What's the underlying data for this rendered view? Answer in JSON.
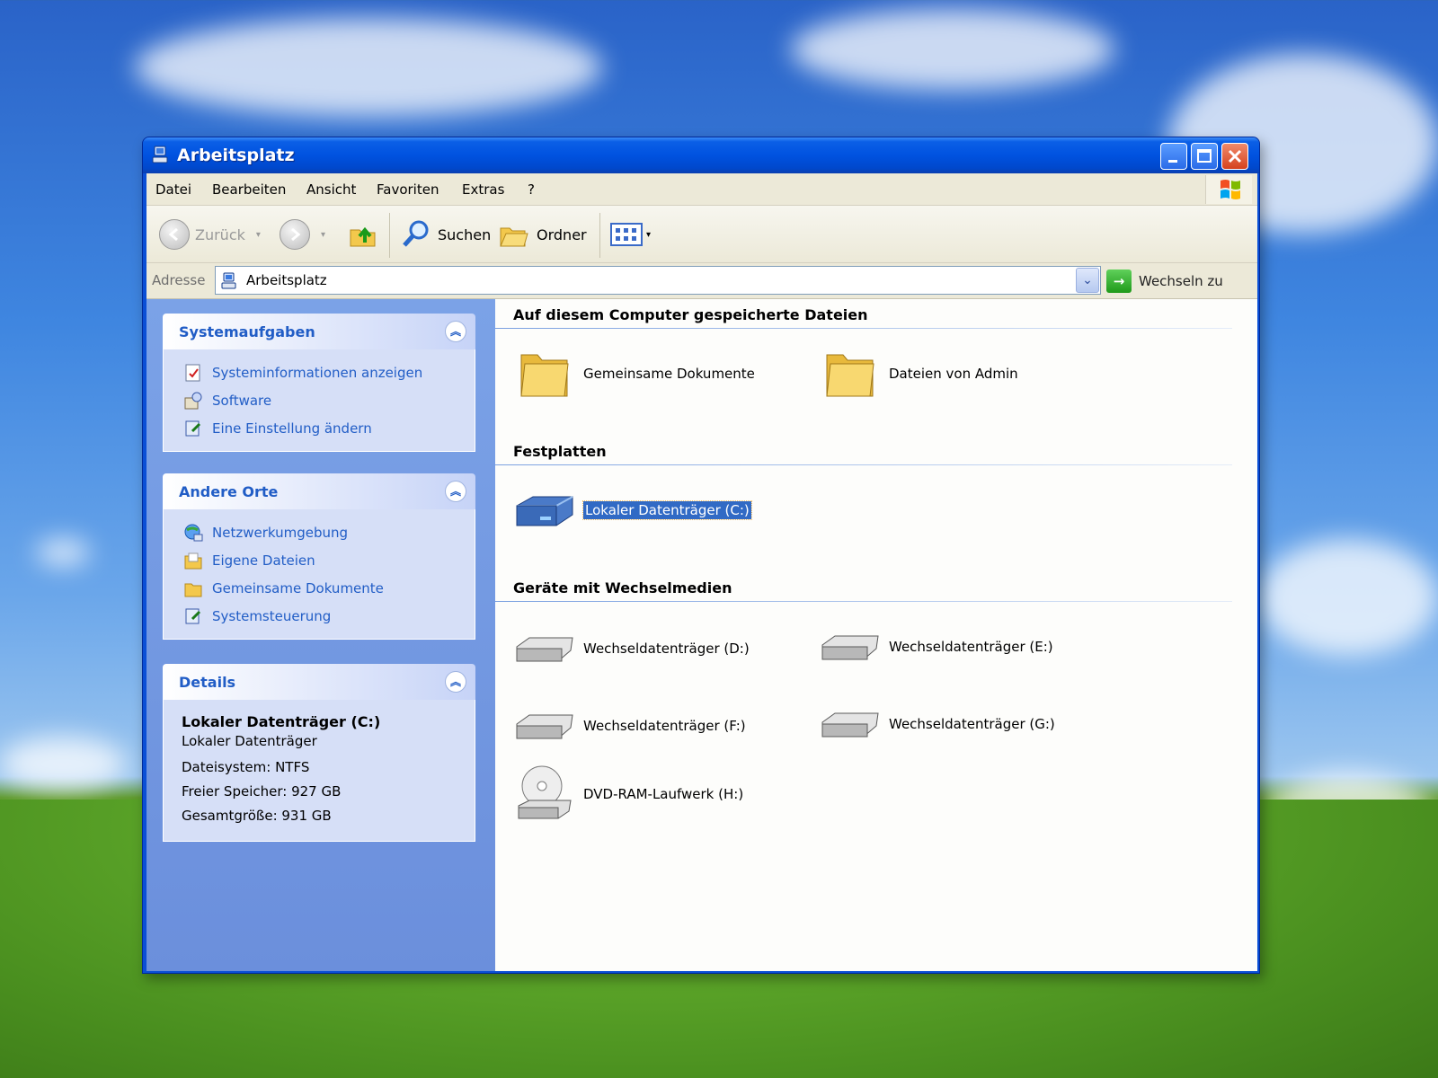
{
  "window": {
    "title": "Arbeitsplatz"
  },
  "menu": [
    "Datei",
    "Bearbeiten",
    "Ansicht",
    "Favoriten",
    "Extras",
    "?"
  ],
  "toolbar": {
    "back_label": "Zurück",
    "search_label": "Suchen",
    "folders_label": "Ordner"
  },
  "address": {
    "label": "Adresse",
    "value": "Arbeitsplatz",
    "go_label": "Wechseln zu"
  },
  "sidebar": {
    "system_tasks": {
      "title": "Systemaufgaben",
      "items": [
        "Systeminformationen anzeigen",
        "Software",
        "Eine Einstellung ändern"
      ]
    },
    "other_places": {
      "title": "Andere Orte",
      "items": [
        "Netzwerkumgebung",
        "Eigene Dateien",
        "Gemeinsame Dokumente",
        "Systemsteuerung"
      ]
    },
    "details": {
      "title": "Details",
      "name": "Lokaler Datenträger (C:)",
      "type": "Lokaler Datenträger",
      "filesystem": "Dateisystem: NTFS",
      "free": "Freier Speicher: 927 GB",
      "total": "Gesamtgröße: 931 GB"
    }
  },
  "content": {
    "stored_files": {
      "title": "Auf diesem Computer gespeicherte Dateien",
      "items": [
        "Gemeinsame Dokumente",
        "Dateien von Admin"
      ]
    },
    "hard_disks": {
      "title": "Festplatten",
      "items": [
        "Lokaler Datenträger (C:)"
      ]
    },
    "removable": {
      "title": "Geräte mit Wechselmedien",
      "items": [
        "Wechseldatenträger (D:)",
        "Wechseldatenträger (E:)",
        "Wechseldatenträger (F:)",
        "Wechseldatenträger (G:)",
        "DVD-RAM-Laufwerk (H:)"
      ]
    }
  },
  "colors": {
    "titlebar": "#0052e0",
    "sidebar": "#7ba2e7",
    "link": "#215dc6",
    "selection": "#316ac5"
  }
}
